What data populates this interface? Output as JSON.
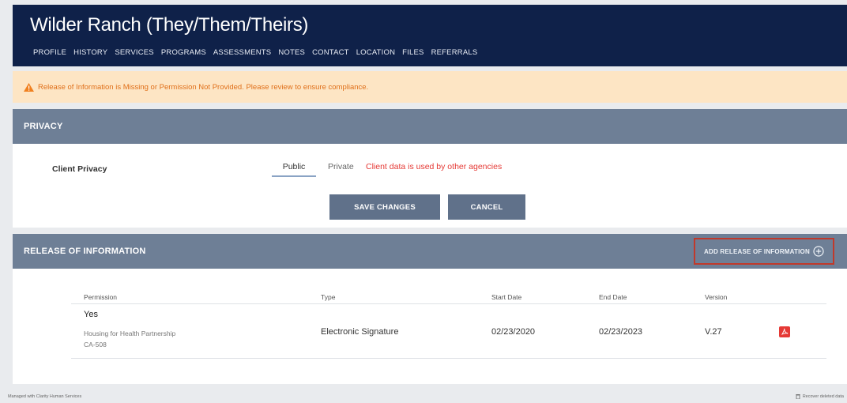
{
  "client": {
    "name": "Wilder Ranch (They/Them/Theirs)"
  },
  "nav": [
    {
      "label": "PROFILE"
    },
    {
      "label": "HISTORY"
    },
    {
      "label": "SERVICES"
    },
    {
      "label": "PROGRAMS"
    },
    {
      "label": "ASSESSMENTS"
    },
    {
      "label": "NOTES"
    },
    {
      "label": "CONTACT"
    },
    {
      "label": "LOCATION"
    },
    {
      "label": "FILES"
    },
    {
      "label": "REFERRALS"
    }
  ],
  "alert": {
    "text": "Release of Information is Missing or Permission Not Provided. Please review to ensure compliance.",
    "icon": "warning-icon",
    "color": "#e0701a"
  },
  "privacy": {
    "title": "PRIVACY",
    "label": "Client Privacy",
    "options": [
      {
        "label": "Public",
        "selected": true
      },
      {
        "label": "Private",
        "selected": false
      }
    ],
    "note": "Client data is used by other agencies",
    "save_label": "SAVE CHANGES",
    "cancel_label": "CANCEL"
  },
  "roi": {
    "title": "RELEASE OF INFORMATION",
    "add_label": "ADD RELEASE OF INFORMATION",
    "columns": [
      "Permission",
      "Type",
      "Start Date",
      "End Date",
      "Version"
    ],
    "rows": [
      {
        "permission": "Yes",
        "organization": "Housing for Health Partnership",
        "coc": "CA-508",
        "type": "Electronic Signature",
        "start_date": "02/23/2020",
        "end_date": "02/23/2023",
        "version": "V.27",
        "file_icon": "pdf-icon"
      }
    ]
  },
  "footer": {
    "left": "Managed with Clarity Human Services",
    "right": "Recover deleted data"
  },
  "colors": {
    "header": "#0f2149",
    "panel_bar": "#6e7f96",
    "button": "#60718a",
    "alert_bg": "#fde5c4",
    "error": "#e53935",
    "highlight_border": "#c0392b"
  }
}
